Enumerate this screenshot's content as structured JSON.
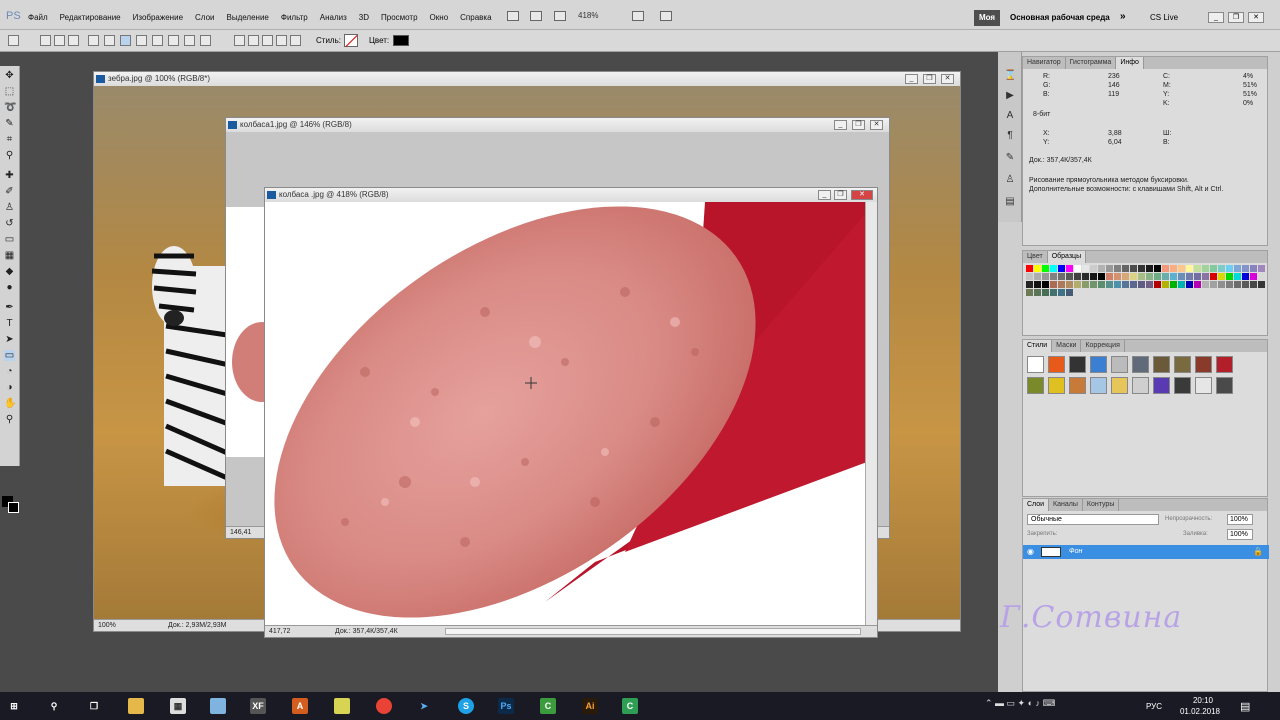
{
  "app": {
    "logo": "PS"
  },
  "menu": [
    "Файл",
    "Редактирование",
    "Изображение",
    "Слои",
    "Выделение",
    "Фильтр",
    "Анализ",
    "3D",
    "Просмотр",
    "Окно",
    "Справка"
  ],
  "appbar": {
    "zoom": "418%",
    "workspace_badge": "Моя",
    "workspace_name": "Основная рабочая среда",
    "cs_live": "CS Live"
  },
  "options": {
    "style_label": "Стиль:",
    "color_label": "Цвет:",
    "color": "#000000"
  },
  "docs": {
    "zebra": {
      "title": "зебра.jpg @ 100% (RGB/8*)",
      "zoom": "100%",
      "doc_size": "Док.: 2,93М/2,93М"
    },
    "kolbasa1": {
      "title": "колбаса1.jpg @ 146% (RGB/8)",
      "zoom": "146,41"
    },
    "kolbasa": {
      "title": "колбаса .jpg @ 418% (RGB/8)",
      "zoom": "417,72",
      "doc_size": "Док.: 357,4К/357,4К"
    }
  },
  "info_panel": {
    "tabs": [
      "Навигатор",
      "Гистограмма",
      "Инфо"
    ],
    "r": "236",
    "g": "146",
    "b": "119",
    "c": "4%",
    "m": "51%",
    "y": "51%",
    "k": "0%",
    "bits": "8-бит",
    "x": "3,88",
    "ycoord": "6,04",
    "w_label": "Ш:",
    "h_label": "В:",
    "doc": "Док.: 357,4К/357,4К",
    "hint1": "Рисование прямоугольника методом буксировки.",
    "hint2": "Дополнительные возможности: с клавишами Shift, Alt и Ctrl."
  },
  "swatches_panel": {
    "tabs": [
      "Цвет",
      "Образцы"
    ]
  },
  "styles_panel": {
    "tabs": [
      "Стили",
      "Маски",
      "Коррекция"
    ]
  },
  "layers_panel": {
    "tabs": [
      "Слои",
      "Каналы",
      "Контуры"
    ],
    "blend_mode": "Обычные",
    "opacity_label": "Непрозрачность:",
    "opacity": "100%",
    "lock_label": "Закрепить:",
    "fill_label": "Заливка:",
    "fill": "100%",
    "layer_name": "Фон"
  },
  "signature": "Г.Сотвина",
  "taskbar": {
    "lang": "РУС",
    "time": "20:10",
    "date": "01.02.2018"
  },
  "colors": {
    "accent": "#3b8fe3",
    "taskbar": "#1a1a24",
    "sausage": "#d88a86"
  }
}
